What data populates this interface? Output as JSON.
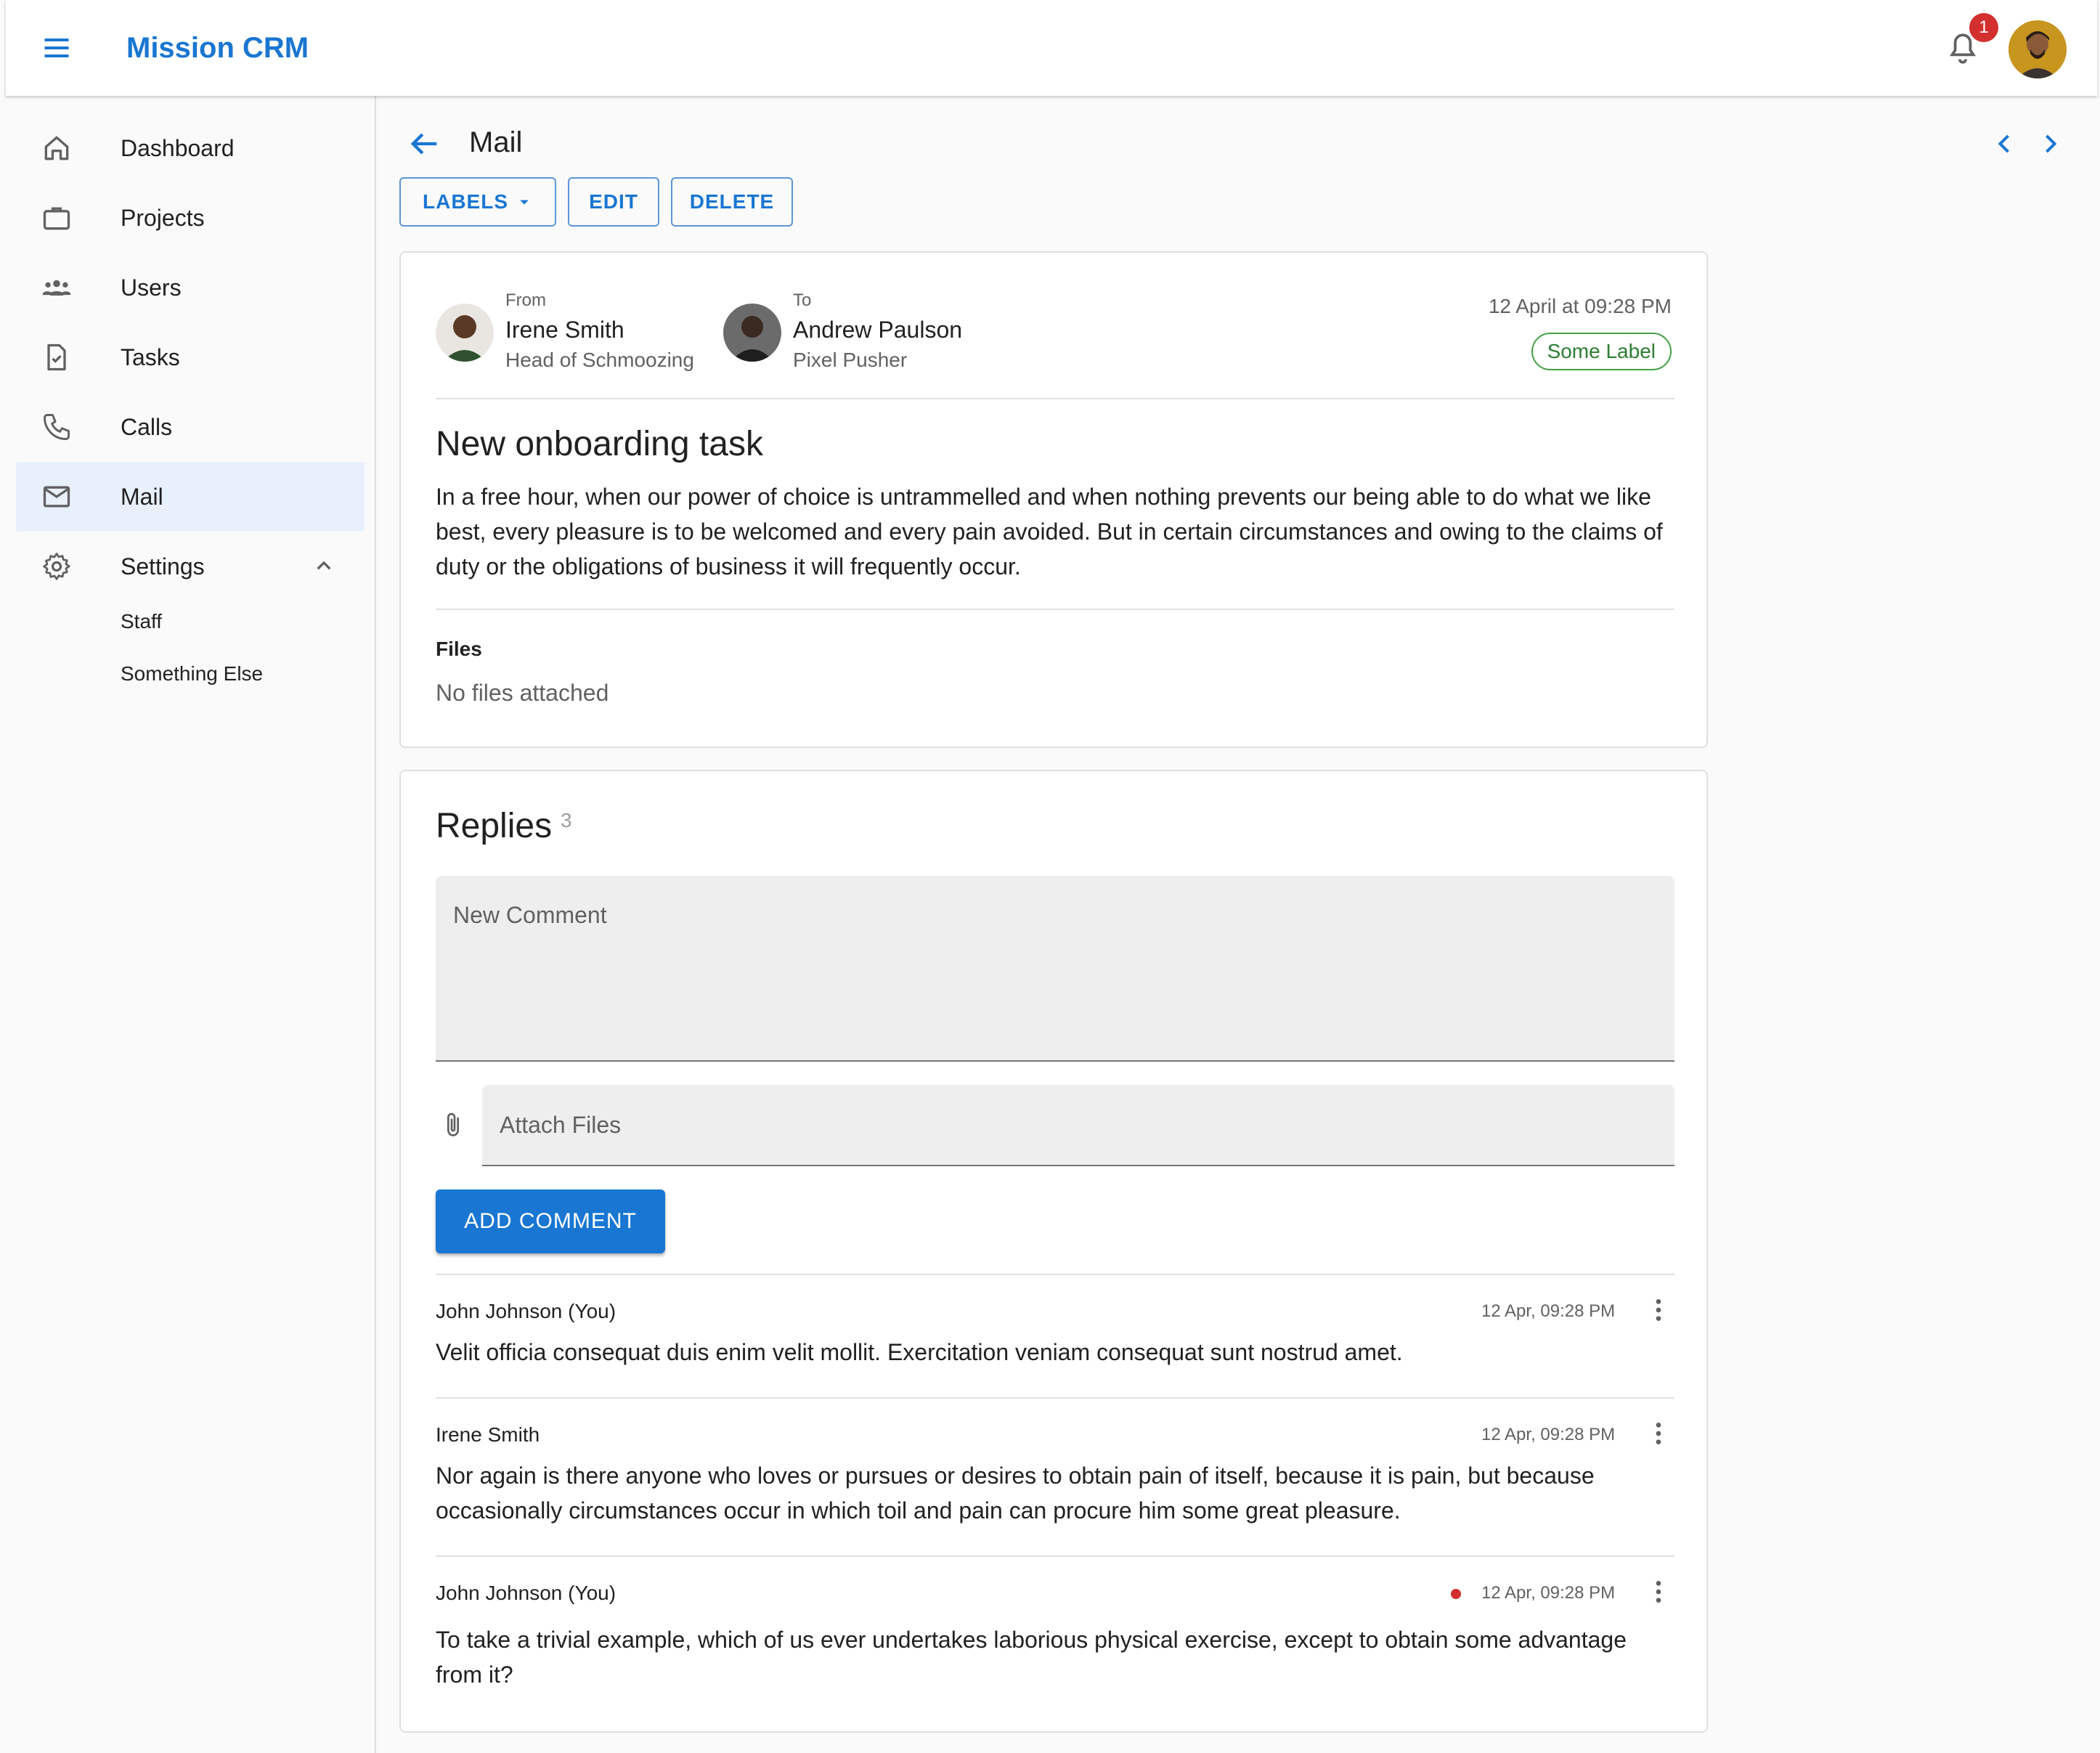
{
  "app": {
    "title": "Mission CRM",
    "notification_count": "1"
  },
  "sidebar": {
    "items": [
      {
        "label": "Dashboard",
        "icon": "home-icon"
      },
      {
        "label": "Projects",
        "icon": "briefcase-icon"
      },
      {
        "label": "Users",
        "icon": "users-icon"
      },
      {
        "label": "Tasks",
        "icon": "task-icon"
      },
      {
        "label": "Calls",
        "icon": "phone-icon"
      },
      {
        "label": "Mail",
        "icon": "mail-icon",
        "active": true
      },
      {
        "label": "Settings",
        "icon": "gear-icon",
        "expanded": true
      }
    ],
    "settings_children": [
      "Staff",
      "Something Else"
    ]
  },
  "page": {
    "title": "Mail",
    "actions": {
      "labels": "LABELS",
      "edit": "EDIT",
      "delete": "DELETE"
    }
  },
  "mail": {
    "from_caption": "From",
    "from_name": "Irene Smith",
    "from_role": "Head of Schmoozing",
    "to_caption": "To",
    "to_name": "Andrew Paulson",
    "to_role": "Pixel Pusher",
    "date": "12 April at 09:28 PM",
    "label": "Some Label",
    "subject": "New onboarding task",
    "body": "In a free hour, when our power of choice is untrammelled and when nothing prevents our being able to do what we like best, every pleasure is to be welcomed and every pain avoided. But in certain circumstances and owing to the claims of duty or the obligations of business it will frequently occur.",
    "files_heading": "Files",
    "files_empty": "No files attached"
  },
  "replies": {
    "heading": "Replies",
    "count": "3",
    "comment_placeholder": "New Comment",
    "attach_placeholder": "Attach Files",
    "add_button": "ADD COMMENT",
    "items": [
      {
        "author": "John Johnson (You)",
        "time": "12 Apr, 09:28 PM",
        "text": "Velit officia consequat duis enim velit mollit. Exercitation veniam consequat sunt nostrud amet.",
        "unread": false
      },
      {
        "author": "Irene Smith",
        "time": "12 Apr, 09:28 PM",
        "text": "Nor again is there anyone who loves or pursues or desires to obtain pain of itself, because it is pain, but because occasionally circumstances occur in which toil and pain can procure him some great pleasure.",
        "unread": false
      },
      {
        "author": "John Johnson (You)",
        "time": "12 Apr, 09:28 PM",
        "text": "To take a trivial example, which of us ever undertakes laborious physical exercise, except to obtain some advantage from it?",
        "unread": true
      }
    ]
  },
  "colors": {
    "primary": "#1976d2",
    "badge": "#d32f2f",
    "label_green": "#43a047",
    "active_nav": "#e8f0fb"
  }
}
